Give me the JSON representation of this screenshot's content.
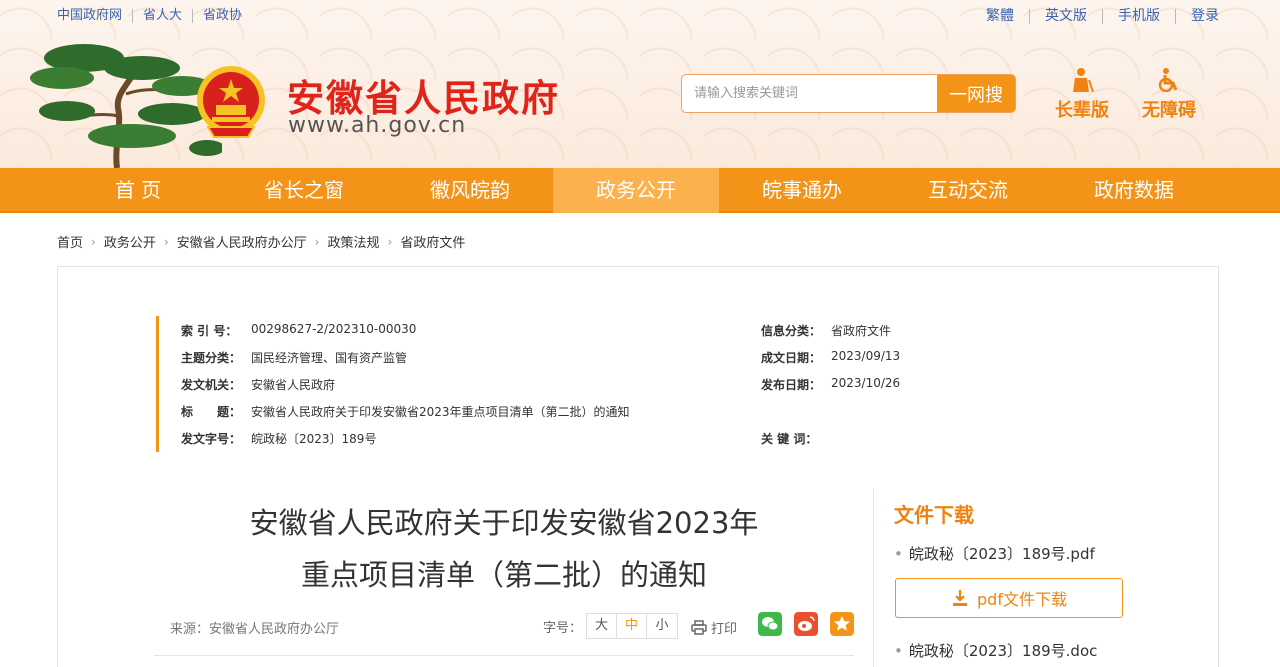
{
  "header": {
    "top_links": [
      "中国政府网",
      "省人大",
      "省政协"
    ],
    "top_right": [
      "繁體",
      "英文版",
      "手机版",
      "登录"
    ],
    "site_title": "安徽省人民政府",
    "site_url": "www.ah.gov.cn",
    "search": {
      "placeholder": "请输入搜索关键词",
      "button": "一网搜"
    },
    "modes": [
      "长辈版",
      "无障碍"
    ]
  },
  "nav": {
    "items": [
      "首 页",
      "省长之窗",
      "徽风皖韵",
      "政务公开",
      "皖事通办",
      "互动交流",
      "政府数据"
    ],
    "active": "政务公开"
  },
  "breadcrumb": [
    "首页",
    "政务公开",
    "安徽省人民政府办公厅",
    "政策法规",
    "省政府文件"
  ],
  "meta": {
    "index_label": "索 引 号：",
    "index": "00298627-2/202310-00030",
    "category_label": "信息分类：",
    "category": "省政府文件",
    "topic_label": "主题分类：",
    "topic": "国民经济管理、国有资产监管",
    "date_made_label": "成文日期：",
    "date_made": "2023/09/13",
    "issuer_label": "发文机关：",
    "issuer": "安徽省人民政府",
    "date_pub_label": "发布日期：",
    "date_pub": "2023/10/26",
    "title_label": "标　　题：",
    "title": "安徽省人民政府关于印发安徽省2023年重点项目清单（第二批）的通知",
    "doc_no_label": "发文字号：",
    "doc_no": "皖政秘〔2023〕189号",
    "keywords_label": "关 键 词：",
    "keywords": ""
  },
  "article": {
    "title_line1": "安徽省人民政府关于印发安徽省2023年",
    "title_line2": "重点项目清单（第二批）的通知",
    "source": "来源：安徽省人民政府办公厅",
    "font_size_label": "字号：",
    "font_sizes": [
      "大",
      "中",
      "小"
    ],
    "font_size_active": "中",
    "print": "打印"
  },
  "sidebar": {
    "title": "文件下载",
    "files": [
      "皖政秘〔2023〕189号.pdf",
      "皖政秘〔2023〕189号.doc"
    ],
    "pdf_button": "pdf文件下载"
  },
  "colors": {
    "accent": "#f39318",
    "title_red": "#e0241a",
    "link_blue": "#3a63b0"
  }
}
